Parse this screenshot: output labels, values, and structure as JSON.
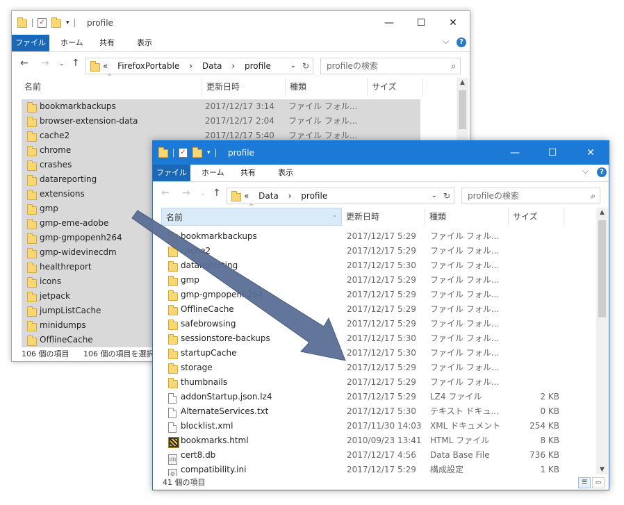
{
  "win1": {
    "title": "profile",
    "tabs": [
      "ファイル",
      "ホーム",
      "共有",
      "表示"
    ],
    "crumbs": [
      "«",
      "FirefoxPortable",
      "›",
      "Data",
      "›",
      "profile"
    ],
    "search_placeholder": "profileの検索",
    "columns": [
      "名前",
      "更新日時",
      "種類",
      "サイズ"
    ],
    "rows": [
      {
        "name": "bookmarkbackups",
        "date": "2017/12/17 3:14",
        "type": "ファイル フォル..."
      },
      {
        "name": "browser-extension-data",
        "date": "2017/12/17 2:04",
        "type": "ファイル フォル..."
      },
      {
        "name": "cache2",
        "date": "2017/12/17 5:40",
        "type": "ファイル フォル..."
      },
      {
        "name": "chrome",
        "date": "",
        "type": ""
      },
      {
        "name": "crashes",
        "date": "",
        "type": ""
      },
      {
        "name": "datareporting",
        "date": "",
        "type": ""
      },
      {
        "name": "extensions",
        "date": "",
        "type": ""
      },
      {
        "name": "gmp",
        "date": "",
        "type": ""
      },
      {
        "name": "gmp-eme-adobe",
        "date": "",
        "type": ""
      },
      {
        "name": "gmp-gmpopenh264",
        "date": "",
        "type": ""
      },
      {
        "name": "gmp-widevinecdm",
        "date": "",
        "type": ""
      },
      {
        "name": "healthreport",
        "date": "",
        "type": ""
      },
      {
        "name": "icons",
        "date": "",
        "type": ""
      },
      {
        "name": "jetpack",
        "date": "",
        "type": ""
      },
      {
        "name": "jumpListCache",
        "date": "",
        "type": ""
      },
      {
        "name": "minidumps",
        "date": "",
        "type": ""
      },
      {
        "name": "OfflineCache",
        "date": "",
        "type": ""
      }
    ],
    "status_count": "106 個の項目",
    "status_selected": "106 個の項目を選択"
  },
  "win2": {
    "title": "profile",
    "tabs": [
      "ファイル",
      "ホーム",
      "共有",
      "表示"
    ],
    "crumbs": [
      "«",
      "Data",
      "›",
      "profile"
    ],
    "search_placeholder": "profileの検索",
    "columns": [
      "名前",
      "更新日時",
      "種類",
      "サイズ"
    ],
    "rows": [
      {
        "name": "bookmarkbackups",
        "date": "2017/12/17 5:29",
        "type": "ファイル フォル...",
        "size": "",
        "icon": "folder-icon"
      },
      {
        "name": "cache2",
        "date": "2017/12/17 5:29",
        "type": "ファイル フォル...",
        "size": "",
        "icon": "folder-icon"
      },
      {
        "name": "datareporting",
        "date": "2017/12/17 5:30",
        "type": "ファイル フォル...",
        "size": "",
        "icon": "folder-icon"
      },
      {
        "name": "gmp",
        "date": "2017/12/17 5:29",
        "type": "ファイル フォル...",
        "size": "",
        "icon": "folder-icon"
      },
      {
        "name": "gmp-gmpopenh264",
        "date": "2017/12/17 5:29",
        "type": "ファイル フォル...",
        "size": "",
        "icon": "folder-icon"
      },
      {
        "name": "OfflineCache",
        "date": "2017/12/17 5:29",
        "type": "ファイル フォル...",
        "size": "",
        "icon": "folder-icon"
      },
      {
        "name": "safebrowsing",
        "date": "2017/12/17 5:29",
        "type": "ファイル フォル...",
        "size": "",
        "icon": "folder-icon"
      },
      {
        "name": "sessionstore-backups",
        "date": "2017/12/17 5:30",
        "type": "ファイル フォル...",
        "size": "",
        "icon": "folder-icon"
      },
      {
        "name": "startupCache",
        "date": "2017/12/17 5:30",
        "type": "ファイル フォル...",
        "size": "",
        "icon": "folder-icon"
      },
      {
        "name": "storage",
        "date": "2017/12/17 5:29",
        "type": "ファイル フォル...",
        "size": "",
        "icon": "folder-icon"
      },
      {
        "name": "thumbnails",
        "date": "2017/12/17 5:29",
        "type": "ファイル フォル...",
        "size": "",
        "icon": "folder-icon"
      },
      {
        "name": "addonStartup.json.lz4",
        "date": "2017/12/17 5:29",
        "type": "LZ4 ファイル",
        "size": "2 KB",
        "icon": "file-icon"
      },
      {
        "name": "AlternateServices.txt",
        "date": "2017/12/17 5:30",
        "type": "テキスト ドキュ...",
        "size": "0 KB",
        "icon": "file-icon"
      },
      {
        "name": "blocklist.xml",
        "date": "2017/11/30 14:03",
        "type": "XML ドキュメント",
        "size": "254 KB",
        "icon": "file-icon"
      },
      {
        "name": "bookmarks.html",
        "date": "2010/09/23 13:41",
        "type": "HTML ファイル",
        "size": "8 KB",
        "icon": "html-file-icon"
      },
      {
        "name": "cert8.db",
        "date": "2017/12/17 4:56",
        "type": "Data Base File",
        "size": "736 KB",
        "icon": "database-file-icon"
      },
      {
        "name": "compatibility.ini",
        "date": "2017/12/17 5:29",
        "type": "構成設定",
        "size": "1 KB",
        "icon": "settings-file-icon"
      }
    ],
    "status_count": "41 個の項目"
  },
  "colors": {
    "accent": "#1c7ad6",
    "selection": "#d9d9d9",
    "arrow": "#5a6f96"
  }
}
